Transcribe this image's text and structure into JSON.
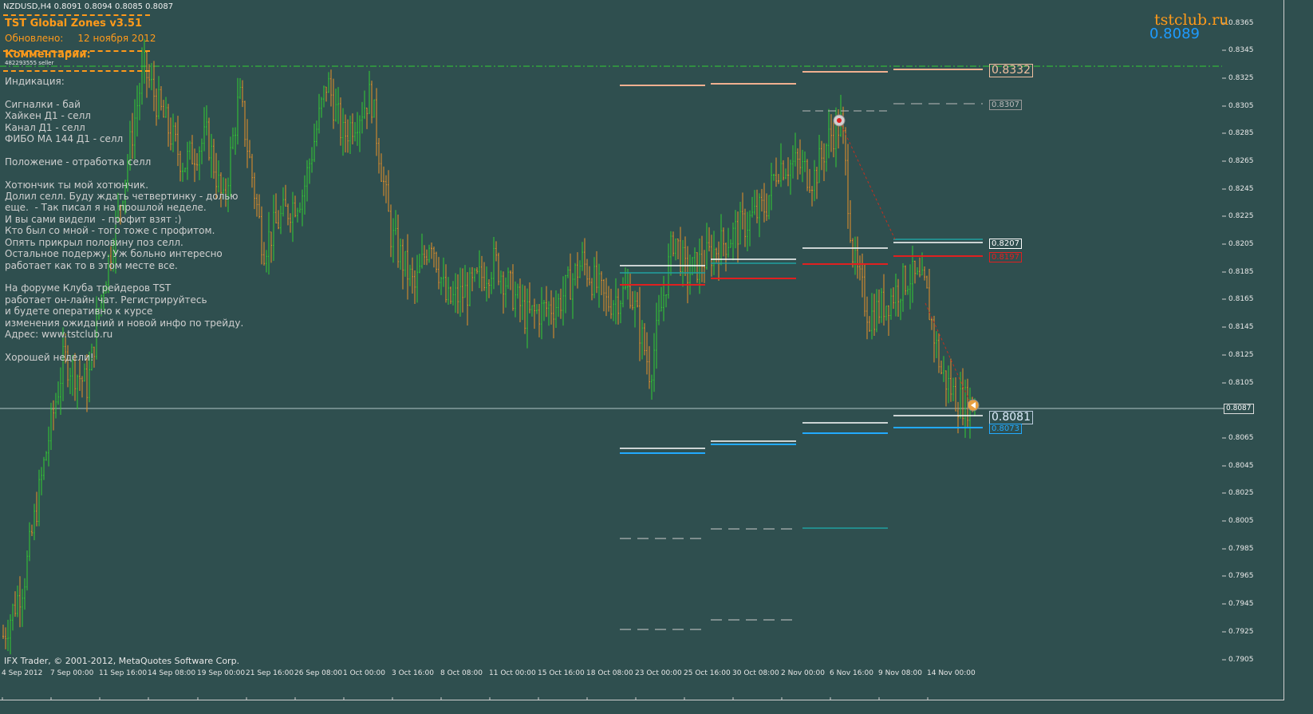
{
  "window": {
    "title_line": "NZDUSD,H4  0.8091 0.8094 0.8085 0.8087"
  },
  "indicator": {
    "name": "TST Global Zones  v3.51",
    "updated_label": "Обновлено:",
    "updated_value": "12 ноября 2012",
    "comments_label": "Комментарии:",
    "tiny_text": "482293555 seller"
  },
  "comment_lines": [
    "Индикация:",
    "",
    "Сигналки - бай",
    "Хайкен Д1 - селл",
    "Канал Д1 - селл",
    "ФИБО МА 144 Д1 - селл",
    "",
    "Положение - отработка селл",
    "",
    "Хотюнчик ты мой хотюнчик.",
    "Долил селл. Буду ждать четвертинку - долью",
    "еще.  - Так писал я на прошлой неделе.",
    "И вы сами видели  - профит взят :)",
    "Кто был со мной - того тоже с профитом.",
    "Опять прикрыл половину поз селл.",
    "Остальное подержу. Уж больно интересно",
    "работает как то в этом месте все.",
    "",
    "На форуме Клуба трейдеров TST",
    "работает он-лайн чат. Регистрируйтесь",
    "и будете оперативно к курсе",
    "изменения ожиданий и новой инфо по трейду.",
    "Адрес: www.tstclub.ru",
    "",
    "Хорошей недели!"
  ],
  "brand": "tstclub.ru",
  "current_price_big": "0.8089",
  "copyright": "IFX Trader, © 2001-2012, MetaQuotes Software Corp.",
  "y_axis": [
    "0.8365",
    "0.8345",
    "0.8325",
    "0.8305",
    "0.8285",
    "0.8265",
    "0.8245",
    "0.8225",
    "0.8205",
    "0.8185",
    "0.8165",
    "0.8145",
    "0.8125",
    "0.8105",
    "0.8087",
    "0.8065",
    "0.8045",
    "0.8025",
    "0.8005",
    "0.7985",
    "0.7965",
    "0.7945",
    "0.7925",
    "0.7905"
  ],
  "x_axis": [
    "4 Sep 2012",
    "7 Sep 00:00",
    "11 Sep 16:00",
    "14 Sep 08:00",
    "19 Sep 00:00",
    "21 Sep 16:00",
    "26 Sep 08:00",
    "1 Oct 00:00",
    "3 Oct 16:00",
    "8 Oct 08:00",
    "11 Oct 00:00",
    "15 Oct 16:00",
    "18 Oct 08:00",
    "23 Oct 00:00",
    "25 Oct 16:00",
    "30 Oct 08:00",
    "2 Nov 00:00",
    "6 Nov 16:00",
    "9 Nov 08:00",
    "14 Nov 00:00"
  ],
  "price_labels": {
    "top": "0.8332",
    "upper": "0.8307",
    "white": "0.8207",
    "red": "0.8197",
    "current": "0.8081",
    "blue": "0.8073",
    "bid": "0.8087"
  },
  "colors": {
    "bull": "#33cc33",
    "bear": "#e8902a",
    "background": "#2f4f4f"
  }
}
